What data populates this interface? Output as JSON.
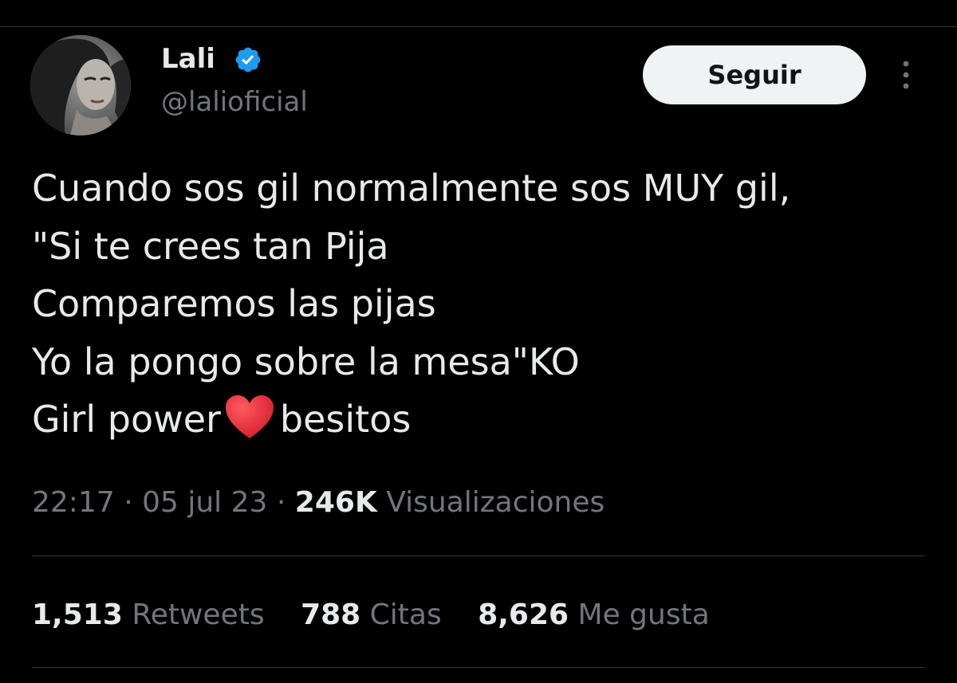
{
  "author": {
    "display_name": "Lali",
    "handle": "@lalioficial",
    "verified": true,
    "verified_color": "#1d9bf0"
  },
  "header": {
    "follow_label": "Seguir",
    "more_icon": "more-vertical-icon"
  },
  "tweet": {
    "lines": [
      "Cuando sos gil normalmente sos MUY gil,",
      "\"Si te crees tan Pija",
      "Comparemos las pijas",
      "Yo la pongo sobre la mesa\"KO"
    ],
    "last_line_before": "Girl power",
    "last_line_emoji": "red-heart-icon",
    "last_line_after": "besitos"
  },
  "meta": {
    "time": "22:17",
    "date": "05 jul 23",
    "views_count": "246K",
    "views_label": "Visualizaciones",
    "separator": "·"
  },
  "stats": {
    "retweets_count": "1,513",
    "retweets_label": "Retweets",
    "quotes_count": "788",
    "quotes_label": "Citas",
    "likes_count": "8,626",
    "likes_label": "Me gusta"
  },
  "colors": {
    "background": "#000000",
    "text_primary": "#e7e9ea",
    "text_secondary": "#71767b",
    "divider": "#2f3336",
    "heart": "#e0313b"
  }
}
